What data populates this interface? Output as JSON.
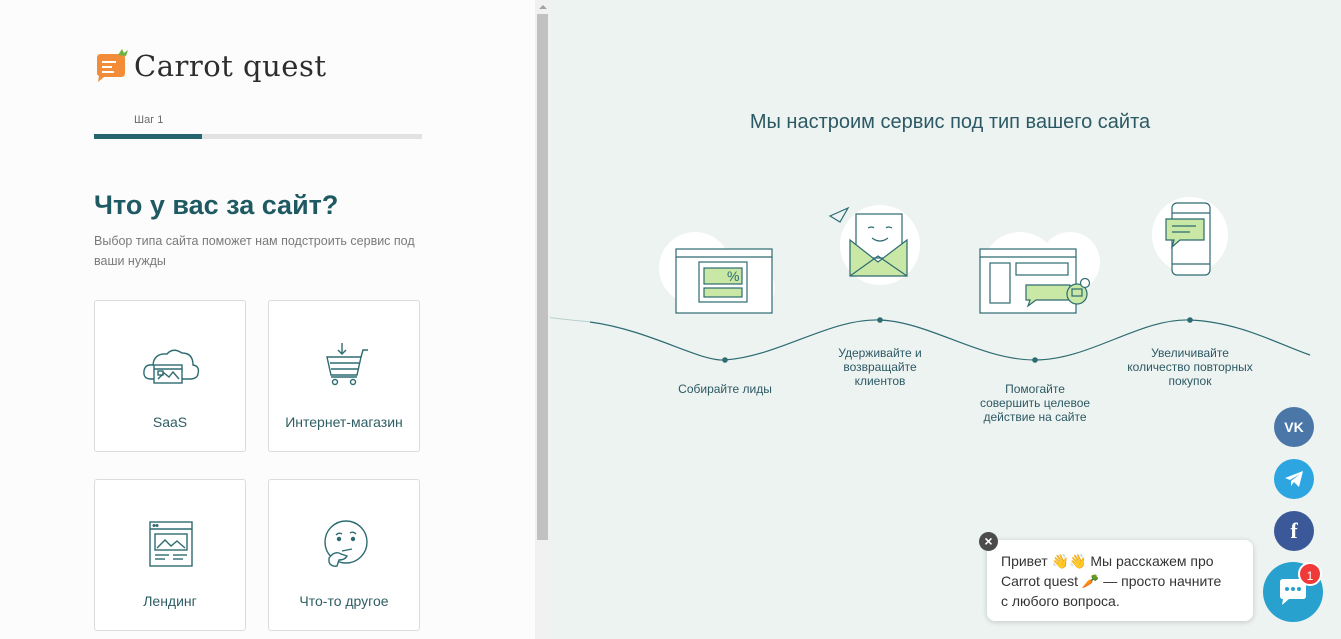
{
  "brand": {
    "name": "Carrot quest"
  },
  "wizard": {
    "step_label": "Шаг 1",
    "progress_fraction": 0.33,
    "heading": "Что у вас за сайт?",
    "subtext": "Выбор типа сайта поможет нам подстроить сервис под ваши нужды",
    "options": [
      {
        "label": "SaaS",
        "icon": "cloud-browser-icon"
      },
      {
        "label": "Интернет-магазин",
        "icon": "shopping-cart-icon"
      },
      {
        "label": "Лендинг",
        "icon": "landing-page-icon"
      },
      {
        "label": "Что-то другое",
        "icon": "thinking-face-icon"
      }
    ]
  },
  "promo": {
    "title": "Мы настроим сервис под тип вашего сайта",
    "steps": [
      {
        "label": "Собирайте лиды",
        "icon": "lead-form-icon"
      },
      {
        "label": "Удерживайте и возвращайте клиентов",
        "icon": "email-envelope-icon"
      },
      {
        "label": "Помогайте совершить целевое действие на сайте",
        "icon": "site-chat-icon"
      },
      {
        "label": "Увеличивайте количество повторных покупок",
        "icon": "mobile-message-icon"
      }
    ]
  },
  "social": [
    {
      "name": "vk",
      "label": "VK",
      "color": "#4a76a8"
    },
    {
      "name": "telegram",
      "color": "#2ca5e0"
    },
    {
      "name": "facebook",
      "label": "f",
      "color": "#3b5998"
    }
  ],
  "chat": {
    "message_line1": "Привет 👋👋 Мы расскажем про",
    "message_line2": "Carrot quest 🥕 — просто начните",
    "message_line3": "с любого вопроса.",
    "close_label": "×",
    "unread_count": "1",
    "accent": "#28a1ce"
  },
  "colors": {
    "primary": "#1f5a63",
    "accent_green": "#c9e8a6",
    "carrot": "#f28c38"
  }
}
